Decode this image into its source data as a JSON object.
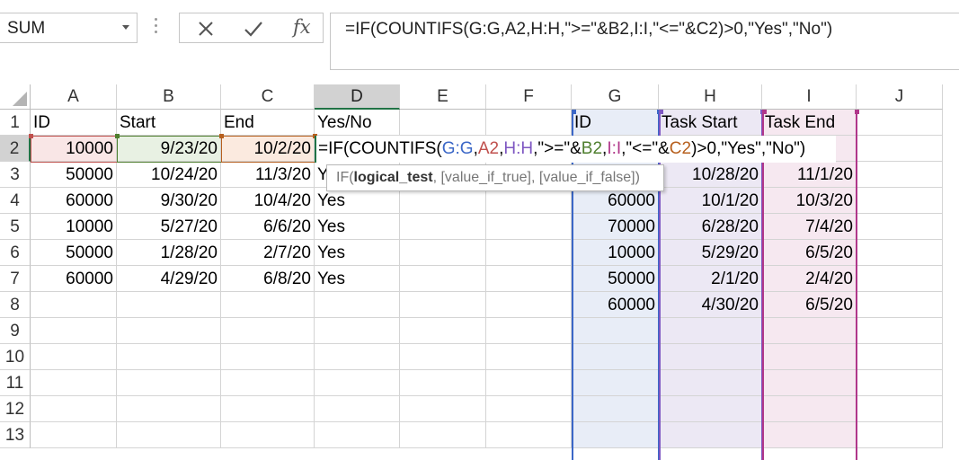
{
  "name_box": {
    "value": "SUM"
  },
  "formula_bar": {
    "cancel_icon": "close-icon",
    "enter_icon": "check-icon",
    "function_label": "fx",
    "formula": "=IF(COUNTIFS(G:G,A2,H:H,\">=\"&B2,I:I,\"<=\"&C2)>0,\"Yes\",\"No\")"
  },
  "columns": [
    "A",
    "B",
    "C",
    "D",
    "E",
    "F",
    "G",
    "H",
    "I",
    "J"
  ],
  "rows": [
    "1",
    "2",
    "3",
    "4",
    "5",
    "6",
    "7",
    "8",
    "9",
    "10",
    "11",
    "12",
    "13"
  ],
  "active_column": "D",
  "active_row": "2",
  "table_left": {
    "headers": {
      "id": "ID",
      "start": "Start",
      "end": "End",
      "yes_no": "Yes/No"
    },
    "data": [
      {
        "id": "10000",
        "start": "9/23/20",
        "end": "10/2/20",
        "yes_no": ""
      },
      {
        "id": "50000",
        "start": "10/24/20",
        "end": "11/3/20",
        "yes_no": "Y"
      },
      {
        "id": "60000",
        "start": "9/30/20",
        "end": "10/4/20",
        "yes_no": "Yes"
      },
      {
        "id": "10000",
        "start": "5/27/20",
        "end": "6/6/20",
        "yes_no": "Yes"
      },
      {
        "id": "50000",
        "start": "1/28/20",
        "end": "2/7/20",
        "yes_no": "Yes"
      },
      {
        "id": "60000",
        "start": "4/29/20",
        "end": "6/8/20",
        "yes_no": "Yes"
      }
    ]
  },
  "table_right": {
    "headers": {
      "id": "ID",
      "task_start": "Task Start",
      "task_end": "Task End"
    },
    "data": [
      {
        "id": "",
        "task_start": "",
        "task_end": ""
      },
      {
        "id": "",
        "task_start": "10/28/20",
        "task_end": "11/1/20"
      },
      {
        "id": "60000",
        "task_start": "10/1/20",
        "task_end": "10/3/20"
      },
      {
        "id": "70000",
        "task_start": "6/28/20",
        "task_end": "7/4/20"
      },
      {
        "id": "10000",
        "task_start": "5/29/20",
        "task_end": "6/5/20"
      },
      {
        "id": "50000",
        "task_start": "2/1/20",
        "task_end": "2/4/20"
      },
      {
        "id": "60000",
        "task_start": "4/30/20",
        "task_end": "6/5/20"
      }
    ]
  },
  "in_cell_formula": {
    "p1": "=IF(COUNTIFS(",
    "r1": "G:G",
    "s1": ",",
    "r2": "A2",
    "s2": ",",
    "r3": "H:H",
    "s3": ",\">=\"&",
    "r4": "B2",
    "s4": ",",
    "r5": "I:I",
    "s5": ",\"<=\"&",
    "r6": "C2",
    "s6": ")>0,\"Yes\",\"No\")"
  },
  "tooltip": {
    "prefix": "IF(",
    "arg1": "logical_test",
    "rest": ", [value_if_true], [value_if_false])"
  },
  "colors": {
    "accent_green": "#217346",
    "ref_g": "#3b67c7",
    "ref_a2": "#c0504d",
    "ref_h": "#7e57c2",
    "ref_b2": "#4f7f2f",
    "ref_i": "#b0378a",
    "ref_c2": "#b7601f"
  }
}
